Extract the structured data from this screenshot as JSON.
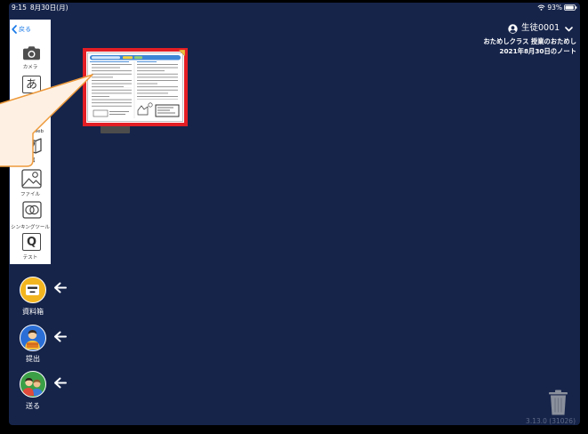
{
  "status_bar": {
    "time": "9:15",
    "date": "8月30日(月)",
    "battery": "93%",
    "icons": [
      "wifi-icon",
      "battery-icon"
    ]
  },
  "toolbar": {
    "back_label": "戻る",
    "tools": [
      {
        "label": "カメラ",
        "icon": "camera-icon"
      },
      {
        "glyph": "あ",
        "icon": "text-icon"
      },
      {
        "label": "Web",
        "icon": "web-icon"
      },
      {
        "label": "地図",
        "icon": "map-icon"
      },
      {
        "label": "ファイル",
        "icon": "image-file-icon"
      },
      {
        "label": "シンキングツール",
        "icon": "thinking-tool-icon"
      },
      {
        "glyph": "Q",
        "label": "テスト",
        "icon": "test-icon"
      }
    ]
  },
  "actions": [
    {
      "label": "資料箱",
      "icon": "drawer-icon",
      "color": "#f3b51f"
    },
    {
      "label": "提出",
      "icon": "submit-person-icon",
      "color": "#2b6fd6"
    },
    {
      "label": "送る",
      "icon": "send-people-icon",
      "color": "#3b9f46"
    }
  ],
  "action_arrow_icon": "arrow-left-icon",
  "user": {
    "name": "生徒0001",
    "icon": "user-circle-icon"
  },
  "note": {
    "class_and_lesson": "おためしクラス 授業のおためし",
    "title": "2021年8月30日のノート"
  },
  "note_card": {
    "selected": true
  },
  "trash_icon": "trash-icon",
  "version": "3.13.0 (31026)",
  "colors": {
    "background": "#16244a",
    "accent": "#1a7ae8",
    "highlight": "#e31e24",
    "callout_stroke": "#ee9a3c",
    "callout_fill": "#fef1e3",
    "version_text": "#5f6986"
  }
}
